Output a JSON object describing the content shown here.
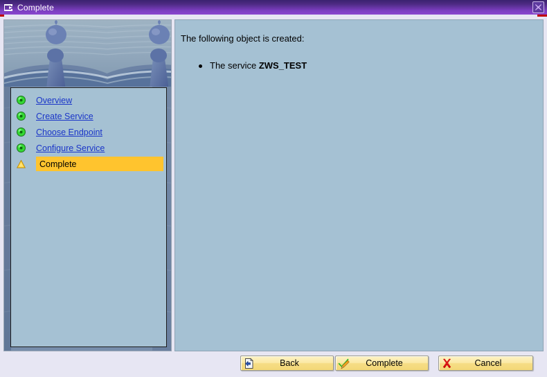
{
  "window": {
    "title": "Complete",
    "title_icon": "window-arrow-icon",
    "close_icon": "close-icon",
    "titlebar_color": "#4d2a83",
    "accent_color": "#8a46cf",
    "panel_color": "#a5c1d3",
    "toolbar_color": "#e7e6f3",
    "highlight_color": "#ffc42e"
  },
  "sidebar": {
    "image_name": "water-droplet-splash-image",
    "items": [
      {
        "label": "Overview",
        "icon": "green-status-icon",
        "state": "done"
      },
      {
        "label": "Create Service",
        "icon": "green-status-icon",
        "state": "done"
      },
      {
        "label": "Choose Endpoint",
        "icon": "green-status-icon",
        "state": "done"
      },
      {
        "label": "Configure Service",
        "icon": "green-status-icon",
        "state": "done"
      },
      {
        "label": "Complete",
        "icon": "warning-triangle-icon",
        "state": "current"
      }
    ]
  },
  "main": {
    "intro": "The following object is created:",
    "bullets": [
      {
        "prefix": "The service ",
        "name": "ZWS_TEST"
      }
    ]
  },
  "buttons": [
    {
      "label": "Back",
      "icon": "back-page-icon"
    },
    {
      "label": "Complete",
      "icon": "check-pencil-icon"
    },
    {
      "label": "Cancel",
      "icon": "red-x-icon"
    }
  ]
}
